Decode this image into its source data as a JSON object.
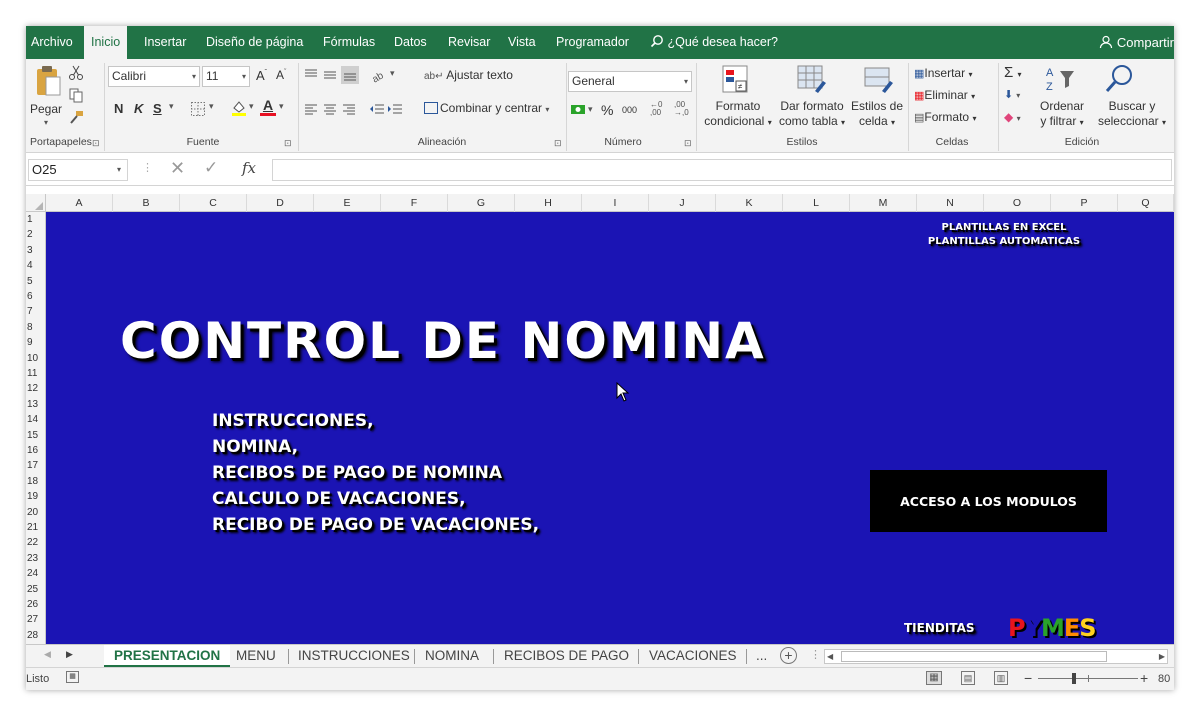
{
  "ribbon_tabs": [
    "Archivo",
    "Inicio",
    "Insertar",
    "Diseño de página",
    "Fórmulas",
    "Datos",
    "Revisar",
    "Vista",
    "Programador"
  ],
  "tell_me": "¿Qué desea hacer?",
  "share": "Compartir",
  "clipboard": {
    "paste": "Pegar",
    "label": "Portapapeles"
  },
  "font": {
    "name": "Calibri",
    "size": "11",
    "bold": "N",
    "italic": "K",
    "underline": "S",
    "label": "Fuente"
  },
  "alignment": {
    "wrap": "Ajustar texto",
    "merge": "Combinar y centrar",
    "label": "Alineación"
  },
  "number": {
    "format": "General",
    "percent": "%",
    "thousands": "000",
    "label": "Número"
  },
  "styles": {
    "conditional_1": "Formato",
    "conditional_2": "condicional",
    "table_1": "Dar formato",
    "table_2": "como tabla",
    "cell_1": "Estilos de",
    "cell_2": "celda",
    "label": "Estilos"
  },
  "cells": {
    "insert": "Insertar",
    "delete": "Eliminar",
    "format": "Formato",
    "label": "Celdas"
  },
  "editing": {
    "sort_1": "Ordenar",
    "sort_2": "y filtrar",
    "find_1": "Buscar y",
    "find_2": "seleccionar",
    "label": "Edición"
  },
  "formula_bar": {
    "name_box": "O25",
    "fx": "fx",
    "value": ""
  },
  "columns": [
    "A",
    "B",
    "C",
    "D",
    "E",
    "F",
    "G",
    "H",
    "I",
    "J",
    "K",
    "L",
    "M",
    "N",
    "O",
    "P",
    "Q"
  ],
  "rows": [
    "1",
    "2",
    "3",
    "4",
    "5",
    "6",
    "7",
    "8",
    "9",
    "10",
    "11",
    "12",
    "13",
    "14",
    "15",
    "16",
    "17",
    "18",
    "19",
    "20",
    "21",
    "22",
    "23",
    "24",
    "25",
    "26",
    "27",
    "28"
  ],
  "sheet": {
    "brand_line_1": "PLANTILLAS EN EXCEL",
    "brand_line_2": "PLANTILLAS AUTOMATICAS",
    "title": "CONTROL DE NOMINA",
    "items": [
      "INSTRUCCIONES,",
      "NOMINA,",
      "RECIBOS DE PAGO DE NOMINA",
      "CALCULO DE VACACIONES,",
      "RECIBO DE PAGO DE VACACIONES,"
    ],
    "access_button": "ACCESO A LOS MODULOS",
    "footer_label": "TIENDITAS",
    "pymes_letters": [
      "P",
      "Y",
      "M",
      "E",
      "S"
    ],
    "pymes_colors": [
      "#e8141c",
      "#1b14b4",
      "#2aa32a",
      "#ff8c00",
      "#ffd21f"
    ],
    "background": "#1b14b4"
  },
  "sheet_tabs": [
    "PRESENTACION",
    "MENU",
    "INSTRUCCIONES",
    "NOMINA",
    "RECIBOS DE PAGO",
    "VACACIONES",
    "..."
  ],
  "status": {
    "ready": "Listo",
    "zoom": "80"
  },
  "accent": "#217346"
}
